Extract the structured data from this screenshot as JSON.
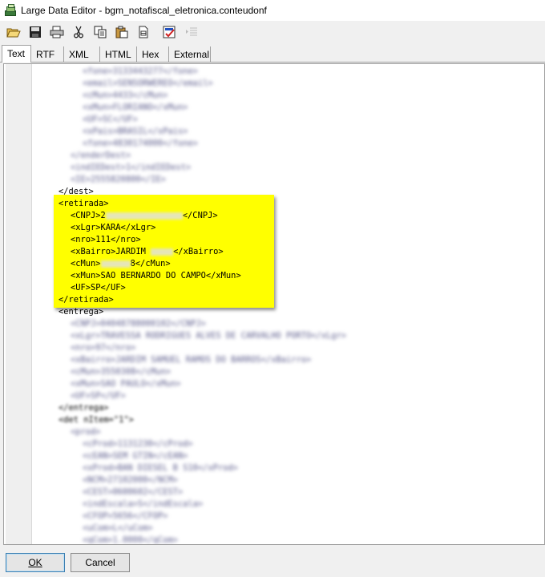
{
  "window": {
    "title": "Large Data Editor - bgm_notafiscal_eletronica.conteudonf"
  },
  "toolbar": {
    "icons": [
      "open-folder-icon",
      "save-icon",
      "print-icon",
      "cut-icon",
      "copy-icon",
      "paste-icon",
      "file-icon",
      "spellcheck-icon",
      "indent-icon"
    ]
  },
  "tabs": [
    "Text",
    "RTF",
    "XML",
    "HTML",
    "Hex",
    "External"
  ],
  "active_tab": "Text",
  "editor": {
    "lines_top": [
      "<fone>3133443277</fone>",
      "<email>SENSORWEREO</email>",
      "<cMun>4433</cMun>",
      "<xMun>FLORIANO</xMun>",
      "<UF>SC</UF>",
      "<xPais>BRASIL</xPais>",
      "<fone>4830174000</fone>",
      "</enderDest>",
      "<indIEDest>1</indIEDest>",
      "<IE>2555820800</IE>",
      "</dest>"
    ],
    "dest_close": "</dest>",
    "retirada": {
      "open": "<retirada>",
      "cnpj_open": "<CNPJ>2",
      "cnpj_close": "</CNPJ>",
      "xlgr": "<xLgr>KARA</xLgr>",
      "nro": "<nro>111</nro>",
      "xbairro_open": "<xBairro>JARDIM ",
      "xbairro_close": "</xBairro>",
      "cmun_open": "<cMun>",
      "cmun_tail": "8</cMun>",
      "xmun": "<xMun>SAO BERNARDO DO CAMPO</xMun>",
      "uf": "<UF>SP</UF>",
      "close": "</retirada>"
    },
    "entrega_open": "<entrega>",
    "lines_entrega": [
      "<CNPJ>04048788000102</CNPJ>",
      "<xLgr>TRAVESSA RODRIGUES ALVES DE CARVALHO PORTO</xLgr>",
      "<nro>97</nro>",
      "<xBairro>JARDIM SAMUEL RAMOS DO BARROS</xBairro>",
      "<cMun>3550308</cMun>",
      "<xMun>SAO PAULO</xMun>",
      "<UF>SP</UF>"
    ],
    "entrega_close": "</entrega>",
    "det_open": "<det nItem=\"1\">",
    "lines_det": [
      "<prod>",
      "<cProd>1131230</cProd>",
      "<cEAN>SEM GTIN</cEAN>",
      "<xProd>BAN DIESEL B S10</xProd>",
      "<NCM>27102000</NCM>",
      "<CEST>0600602</CEST>",
      "<indEscala>S</indEscala>",
      "<CFOP>5656</CFOP>",
      "<uCom>L</uCom>",
      "<qCom>1.0000</qCom>"
    ]
  },
  "buttons": {
    "ok": "OK",
    "cancel": "Cancel"
  },
  "colors": {
    "highlight": "#ffff00",
    "tag_blur": "#5a5a8a"
  }
}
